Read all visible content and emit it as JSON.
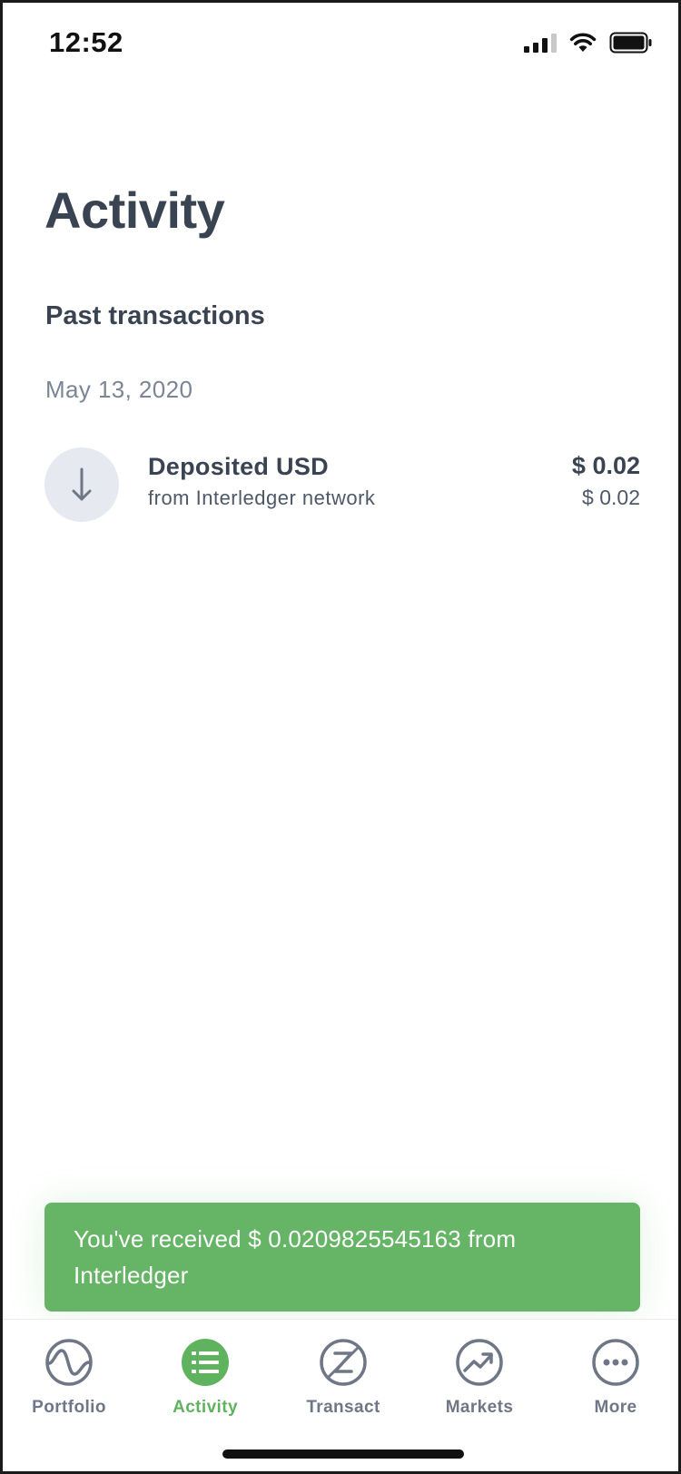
{
  "status_bar": {
    "time": "12:52",
    "icons": [
      "signal-icon",
      "wifi-icon",
      "battery-icon"
    ]
  },
  "header": {
    "title": "Activity"
  },
  "section": {
    "title": "Past transactions",
    "date": "May 13, 2020"
  },
  "transactions": [
    {
      "icon": "arrow-down-icon",
      "title": "Deposited USD",
      "subtitle": "from Interledger network",
      "amount": "$ 0.02",
      "amount_secondary": "$ 0.02"
    }
  ],
  "toast": {
    "message": "You've received $ 0.0209825545163 from Interledger"
  },
  "bottom_nav": {
    "items": [
      {
        "label": "Portfolio",
        "icon": "portfolio-wave-icon",
        "active": false
      },
      {
        "label": "Activity",
        "icon": "activity-list-icon",
        "active": true
      },
      {
        "label": "Transact",
        "icon": "transact-z-icon",
        "active": false
      },
      {
        "label": "Markets",
        "icon": "markets-trend-icon",
        "active": false
      },
      {
        "label": "More",
        "icon": "more-dots-icon",
        "active": false
      }
    ]
  },
  "colors": {
    "accent_green": "#5fb35f",
    "toast_green": "#66b466",
    "text_dark": "#3a4352",
    "text_muted": "#7c8595",
    "icon_gray": "#6f7787"
  }
}
